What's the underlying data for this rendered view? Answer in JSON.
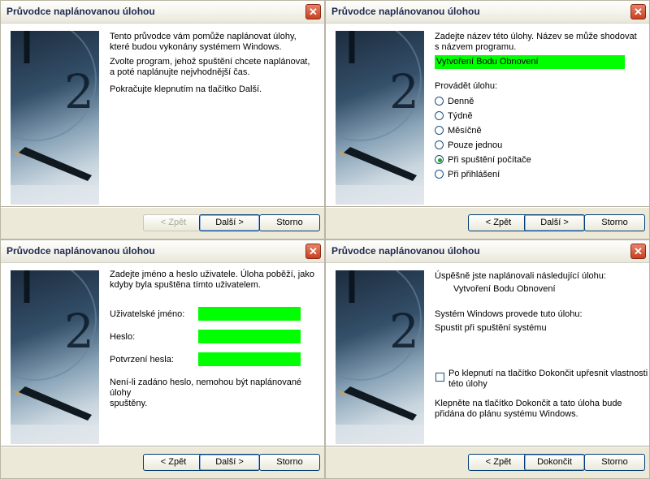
{
  "window_title": "Průvodce naplánovanou úlohou",
  "close_glyph": "✕",
  "buttons": {
    "back": "< Zpět",
    "next": "Další >",
    "cancel": "Storno",
    "finish": "Dokončit"
  },
  "panel1": {
    "text1": [
      "Tento průvodce vám pomůže naplánovat úlohy,",
      "které budou vykonány systémem Windows."
    ],
    "text2": [
      "Zvolte program, jehož spuštění chcete naplánovat,",
      "a poté naplánujte nejvhodnější čas."
    ],
    "text3": "Pokračujte klepnutím na tlačítko Další."
  },
  "panel2": {
    "prompt": [
      "Zadejte název této úlohy. Název se může shodovat",
      "s názvem programu."
    ],
    "task_name": "Vytvoření Bodu Obnovení",
    "perform_label": "Provádět úlohu:",
    "options": [
      "Denně",
      "Týdně",
      "Měsíčně",
      "Pouze jednou",
      "Při spuštění počítače",
      "Při přihlášení"
    ],
    "selected_index": 4
  },
  "panel3": {
    "prompt": [
      "Zadejte jméno a heslo uživatele. Úloha poběží, jako",
      "kdyby byla spuštěna tímto uživatelem."
    ],
    "username_label": "Uživatelské jméno:",
    "password_label": "Heslo:",
    "confirm_label": "Potvrzení hesla:",
    "note": [
      "Není-li zadáno heslo, nemohou být naplánované úlohy",
      "spuštěny."
    ]
  },
  "panel4": {
    "success": "Úspěšně jste naplánovali následující úlohu:",
    "task_name": "Vytvoření Bodu Obnovení",
    "windows_will": "Systém Windows provede tuto úlohu:",
    "schedule": "Spustit při spuštění systému",
    "checkbox_label": [
      "Po klepnutí na tlačítko Dokončit upřesnit vlastnosti",
      "této úlohy"
    ],
    "finish_note": [
      "Klepněte na tlačítko Dokončit a tato úloha bude",
      "přidána do plánu systému Windows."
    ]
  },
  "colors": {
    "field_highlight": "#00ff00",
    "close_button": "#d1502f"
  }
}
